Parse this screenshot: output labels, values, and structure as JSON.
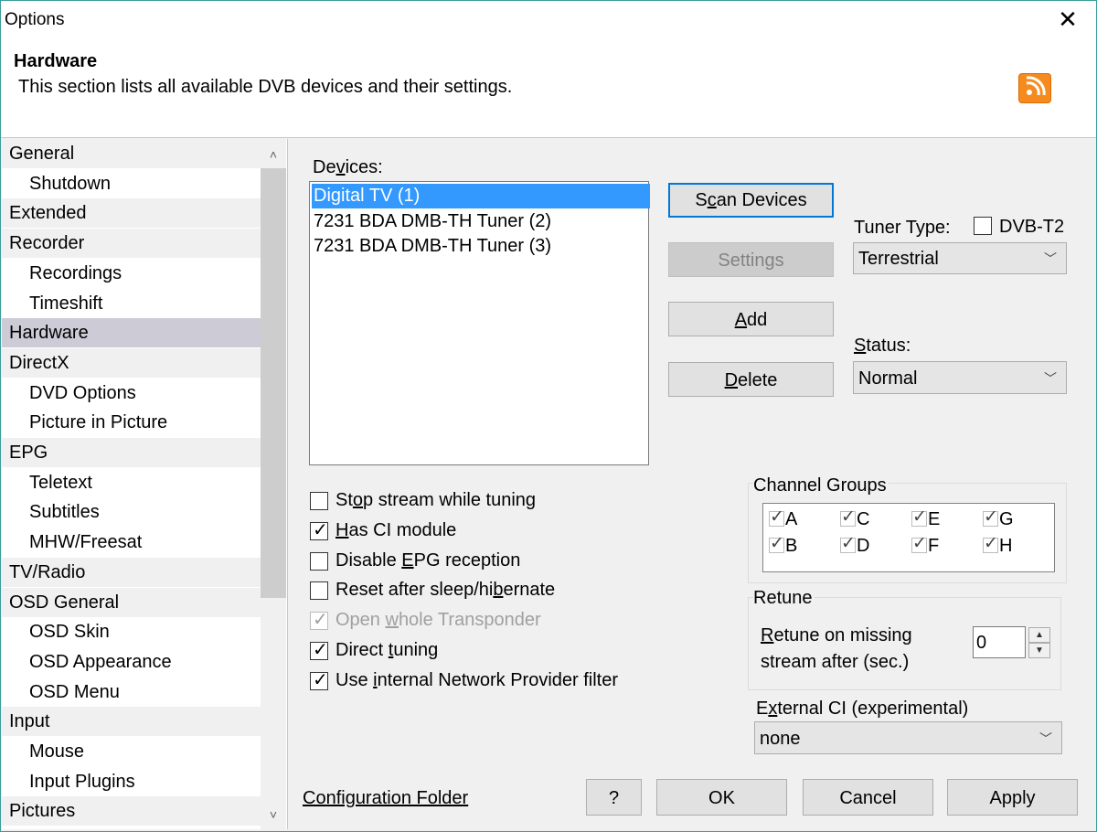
{
  "window": {
    "title": "Options",
    "close_glyph": "✕"
  },
  "header": {
    "title": "Hardware",
    "description": "This section lists all available DVB devices and their settings.",
    "icon": "rss-icon",
    "icon_color": "#f58a1f"
  },
  "tree": {
    "items": [
      {
        "label": "General",
        "level": 0
      },
      {
        "label": "Shutdown",
        "level": 1
      },
      {
        "label": "Extended",
        "level": 0
      },
      {
        "label": "Recorder",
        "level": 0
      },
      {
        "label": "Recordings",
        "level": 1
      },
      {
        "label": "Timeshift",
        "level": 1
      },
      {
        "label": "Hardware",
        "level": 0,
        "selected": true
      },
      {
        "label": "DirectX",
        "level": 0
      },
      {
        "label": "DVD Options",
        "level": 1
      },
      {
        "label": "Picture in Picture",
        "level": 1
      },
      {
        "label": "EPG",
        "level": 0
      },
      {
        "label": "Teletext",
        "level": 1
      },
      {
        "label": "Subtitles",
        "level": 1
      },
      {
        "label": "MHW/Freesat",
        "level": 1
      },
      {
        "label": "TV/Radio",
        "level": 0
      },
      {
        "label": "OSD General",
        "level": 0
      },
      {
        "label": "OSD Skin",
        "level": 1
      },
      {
        "label": "OSD Appearance",
        "level": 1
      },
      {
        "label": "OSD Menu",
        "level": 1
      },
      {
        "label": "Input",
        "level": 0
      },
      {
        "label": "Mouse",
        "level": 1
      },
      {
        "label": "Input Plugins",
        "level": 1
      },
      {
        "label": "Pictures",
        "level": 0
      }
    ],
    "scroll_up": "˄",
    "scroll_down": "˅"
  },
  "devices": {
    "label_pre": "De",
    "label_u": "v",
    "label_post": "ices:",
    "items": [
      "Digital TV (1)",
      "7231 BDA DMB-TH Tuner (2)",
      "7231 BDA DMB-TH Tuner (3)"
    ],
    "selected_index": 0
  },
  "buttons": {
    "scan_pre": "S",
    "scan_u": "c",
    "scan_post": "an Devices",
    "settings": "Settings",
    "add_u": "A",
    "add_post": "dd",
    "delete_u": "D",
    "delete_post": "elete"
  },
  "tuner": {
    "label": "Tuner Type:",
    "dvbt2_label": "DVB-T2",
    "dvbt2_checked": false,
    "value": "Terrestrial"
  },
  "status": {
    "label_u": "S",
    "label_post": "tatus:",
    "value": "Normal"
  },
  "options": [
    {
      "pre": "St",
      "u": "o",
      "post": "p stream while tuning",
      "checked": false,
      "disabled": false
    },
    {
      "pre": "",
      "u": "H",
      "post": "as CI module",
      "checked": true,
      "disabled": false
    },
    {
      "pre": "Disable ",
      "u": "E",
      "post": "PG reception",
      "checked": false,
      "disabled": false
    },
    {
      "pre": "Reset after sleep/hi",
      "u": "b",
      "post": "ernate",
      "checked": false,
      "disabled": false
    },
    {
      "pre": "Open ",
      "u": "w",
      "post": "hole Transponder",
      "checked": true,
      "disabled": true
    },
    {
      "pre": "Direct ",
      "u": "t",
      "post": "uning",
      "checked": true,
      "disabled": false
    },
    {
      "pre": "Use ",
      "u": "i",
      "post": "nternal Network Provider filter",
      "checked": true,
      "disabled": false
    }
  ],
  "channel_groups": {
    "title": "Channel Groups",
    "items": [
      {
        "label": "A",
        "checked": true
      },
      {
        "label": "C",
        "checked": true
      },
      {
        "label": "E",
        "checked": true
      },
      {
        "label": "G",
        "checked": true
      },
      {
        "label": "B",
        "checked": true
      },
      {
        "label": "D",
        "checked": true
      },
      {
        "label": "F",
        "checked": true
      },
      {
        "label": "H",
        "checked": true
      }
    ]
  },
  "retune": {
    "title": "Retune",
    "label_line1_u": "R",
    "label_line1_post": "etune on missing",
    "label_line2": "stream after (sec.)",
    "value": "0"
  },
  "external_ci": {
    "label_pre": "E",
    "label_u": "x",
    "label_post": "ternal CI (experimental)",
    "value": "none"
  },
  "footer": {
    "config_folder": "Configuration Folder",
    "help": "?",
    "ok": "OK",
    "cancel": "Cancel",
    "apply": "Apply"
  },
  "glyphs": {
    "check": "✓",
    "chevron": "﹀",
    "spin_up": "▲",
    "spin_down": "▼"
  }
}
